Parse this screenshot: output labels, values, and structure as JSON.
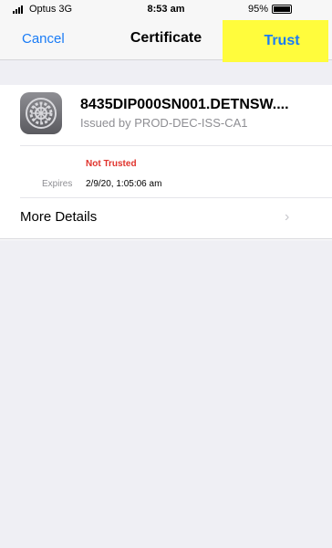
{
  "status_bar": {
    "carrier": "Optus 3G",
    "time": "8:53 am",
    "battery": "95%"
  },
  "nav": {
    "cancel_label": "Cancel",
    "title": "Certificate",
    "trust_label": "Trust"
  },
  "certificate": {
    "name": "8435DIP000SN001.DETNSW....",
    "issuer": "Issued by PROD-DEC-ISS-CA1",
    "status": "Not Trusted",
    "expires_label": "Expires",
    "expires_value": "2/9/20, 1:05:06 am",
    "more_details_label": "More Details"
  },
  "colors": {
    "accent": "#1a7cf6",
    "highlight": "#fffc3c",
    "danger": "#e0332c"
  },
  "icons": {
    "certificate": "settings-gear-icon",
    "chevron": "chevron-right-icon"
  }
}
